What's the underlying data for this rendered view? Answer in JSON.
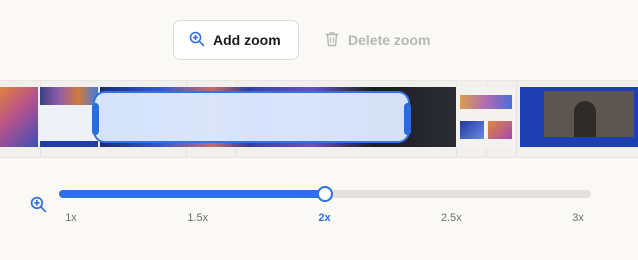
{
  "toolbar": {
    "add_zoom_label": "Add zoom",
    "delete_zoom_label": "Delete zoom"
  },
  "zoom_slider": {
    "ticks": [
      "1x",
      "1.5x",
      "2x",
      "2.5x",
      "3x"
    ],
    "min": 1,
    "max": 3,
    "value": 2,
    "selected_label": "2x"
  },
  "colors": {
    "accent": "#2e70e8",
    "zoom_region_fill": "#ddeaff",
    "disabled_text": "#b7b7b7",
    "background": "#faf9f6"
  },
  "icons": {
    "add_zoom": "zoom-in-icon",
    "delete_zoom": "trash-icon",
    "slider": "zoom-in-icon"
  }
}
